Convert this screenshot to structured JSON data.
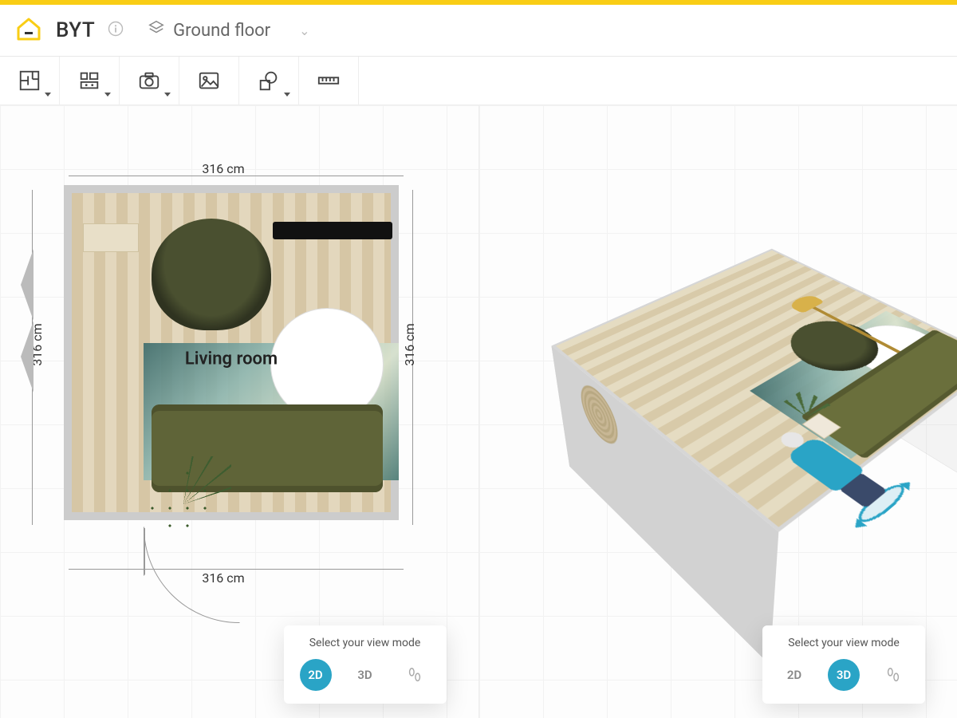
{
  "header": {
    "project_name": "BYT",
    "floor_label": "Ground floor"
  },
  "toolbar": {
    "tools": [
      {
        "name": "floorplan-tool",
        "has_dropdown": true
      },
      {
        "name": "furniture-tool",
        "has_dropdown": true
      },
      {
        "name": "camera-tool",
        "has_dropdown": true
      },
      {
        "name": "image-tool",
        "has_dropdown": false
      },
      {
        "name": "shapes-tool",
        "has_dropdown": true
      },
      {
        "name": "measure-tool",
        "has_dropdown": false
      }
    ]
  },
  "plan": {
    "room_label": "Living room",
    "dimensions": {
      "top": "316 cm",
      "bottom": "316 cm",
      "left": "316 cm",
      "right": "316 cm"
    }
  },
  "viewmode": {
    "label": "Select your view mode",
    "mode_2d": "2D",
    "mode_3d": "3D",
    "left_active": "2D",
    "right_active": "3D"
  },
  "colors": {
    "accent_yellow": "#f9cd15",
    "accent_teal": "#2aa4c6",
    "sofa_green": "#5f6438"
  }
}
